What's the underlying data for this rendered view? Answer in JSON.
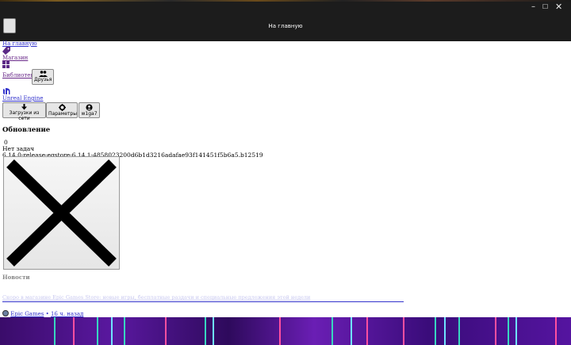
{
  "window": {
    "title": "На главную",
    "controls": {
      "minimize": "–",
      "maximize": "☐",
      "close": "✕"
    }
  },
  "nav": {
    "home_link": "На главную",
    "store_link": "Магазин",
    "library_link": "Библиотека",
    "friends_button": "Друзья",
    "unreal_link": "Unreal Engine",
    "downloads_button": "Загрузки из сети",
    "settings_button": "Параметры",
    "user_button": "w1ga7"
  },
  "update": {
    "heading": "Обновление",
    "count": "0",
    "status": "Нет задач",
    "version": "6.14.0-release-egstore-6.14.1-4858023200d6b1d3216adafae93f141451f5b6a5.b12519"
  },
  "news": {
    "label": "Новости",
    "link_text": "Скоро в магазине Epic Games Store: новые игры, бесплатные раздачи и специальные предложения этой недели",
    "author": "Epic Games",
    "separator": "•",
    "time": "16 ч. назад"
  },
  "colors": {
    "titlebar": "#1c1c1c",
    "link": "#3333cc",
    "visited_link": "#6a2a8a",
    "banner": "#4a148c"
  }
}
